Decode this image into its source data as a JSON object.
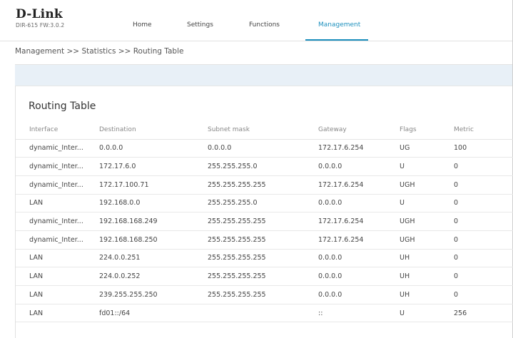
{
  "header": {
    "logo_text": "D-Link",
    "model": "DIR-615 FW:3.0.2",
    "nav": [
      {
        "label": "Home",
        "active": false
      },
      {
        "label": "Settings",
        "active": false
      },
      {
        "label": "Functions",
        "active": false
      },
      {
        "label": "Management",
        "active": true
      }
    ],
    "accent_color": "#1b8fbd"
  },
  "breadcrumb": "Management >> Statistics >> Routing Table",
  "routing_table": {
    "title": "Routing Table",
    "columns": [
      "Interface",
      "Destination",
      "Subnet mask",
      "Gateway",
      "Flags",
      "Metric"
    ],
    "rows": [
      [
        "dynamic_Inter...",
        "0.0.0.0",
        "0.0.0.0",
        "172.17.6.254",
        "UG",
        "100"
      ],
      [
        "dynamic_Inter...",
        "172.17.6.0",
        "255.255.255.0",
        "0.0.0.0",
        "U",
        "0"
      ],
      [
        "dynamic_Inter...",
        "172.17.100.71",
        "255.255.255.255",
        "172.17.6.254",
        "UGH",
        "0"
      ],
      [
        "LAN",
        "192.168.0.0",
        "255.255.255.0",
        "0.0.0.0",
        "U",
        "0"
      ],
      [
        "dynamic_Inter...",
        "192.168.168.249",
        "255.255.255.255",
        "172.17.6.254",
        "UGH",
        "0"
      ],
      [
        "dynamic_Inter...",
        "192.168.168.250",
        "255.255.255.255",
        "172.17.6.254",
        "UGH",
        "0"
      ],
      [
        "LAN",
        "224.0.0.251",
        "255.255.255.255",
        "0.0.0.0",
        "UH",
        "0"
      ],
      [
        "LAN",
        "224.0.0.252",
        "255.255.255.255",
        "0.0.0.0",
        "UH",
        "0"
      ],
      [
        "LAN",
        "239.255.255.250",
        "255.255.255.255",
        "0.0.0.0",
        "UH",
        "0"
      ],
      [
        "LAN",
        "fd01::/64",
        "",
        "::",
        "U",
        "256"
      ]
    ]
  }
}
